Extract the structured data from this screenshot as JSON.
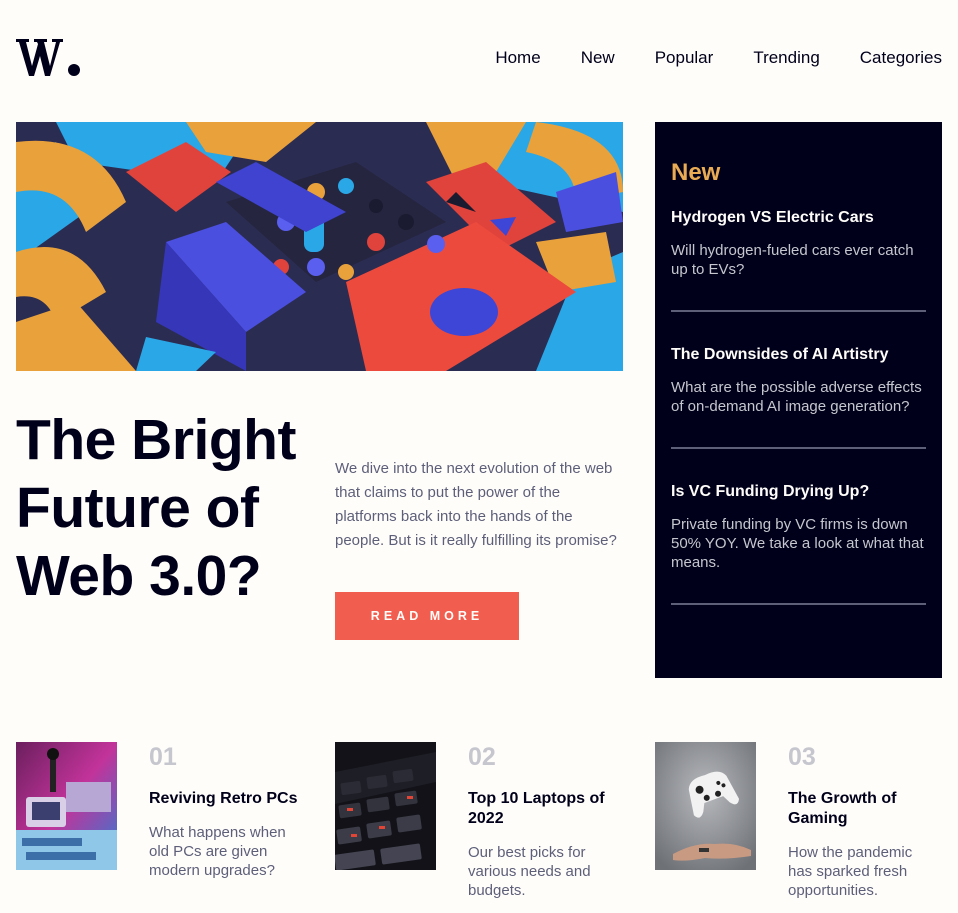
{
  "header": {
    "logo_text": "W.",
    "nav": [
      "Home",
      "New",
      "Popular",
      "Trending",
      "Categories"
    ]
  },
  "hero": {
    "title": "The Bright Future of Web 3.0?",
    "description": "We dive into the next evolution of the web that claims to put the power of the platforms back into the hands of the people. But is it really fulfilling its promise?",
    "button_label": "READ MORE"
  },
  "new_panel": {
    "heading": "New",
    "items": [
      {
        "title": "Hydrogen VS Electric Cars",
        "summary": "Will hydrogen-fueled cars ever catch up to EVs?"
      },
      {
        "title": "The Downsides of AI Artistry",
        "summary": "What are the possible adverse effects of on-demand AI image generation?"
      },
      {
        "title": "Is VC Funding Drying Up?",
        "summary": "Private funding by VC firms is down 50% YOY. We take a look at what that means."
      }
    ]
  },
  "articles": [
    {
      "number": "01",
      "title": "Reviving Retro PCs",
      "summary": "What happens when old PCs are given modern upgrades?"
    },
    {
      "number": "02",
      "title": "Top 10 Laptops of 2022",
      "summary": "Our best picks for various needs and budgets."
    },
    {
      "number": "03",
      "title": "The Growth of Gaming",
      "summary": "How the pandemic has sparked fresh opportunities."
    }
  ],
  "colors": {
    "accent_red": "#f15e50",
    "accent_orange": "#e9ab53",
    "dark_navy": "#00001a",
    "grayish_blue": "#5d5f79",
    "off_white": "#fffdfa"
  }
}
